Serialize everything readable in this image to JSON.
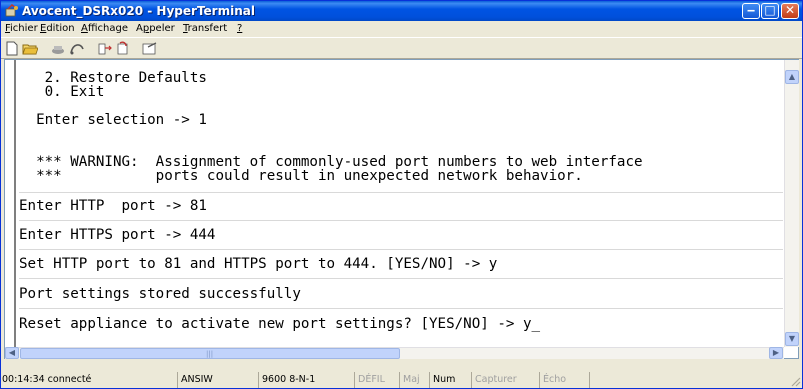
{
  "window": {
    "title": "Avocent_DSRx020 - HyperTerminal",
    "minimize": "‒",
    "maximize": "□",
    "close": "✕"
  },
  "menu": {
    "items": [
      "Fichier",
      "Edition",
      "Affichage",
      "Appeler",
      "Transfert",
      "?"
    ]
  },
  "toolbar": {
    "icons": [
      "new-connection-icon",
      "open-icon",
      "dial-icon",
      "disconnect-icon",
      "send-icon",
      "receive-icon",
      "properties-icon"
    ]
  },
  "terminal": {
    "lines": [
      "   2. Restore Defaults",
      "   0. Exit",
      "",
      "  Enter selection -> 1",
      "",
      "",
      "  *** WARNING:  Assignment of commonly-used port numbers to web interface",
      "  ***           ports could result in unexpected network behavior.",
      "",
      "Enter HTTP  port -> 81",
      "",
      "Enter HTTPS port -> 444",
      "",
      "Set HTTP port to 81 and HTTPS port to 444. [YES/NO] -> y",
      "",
      "Port settings stored successfully",
      "",
      "Reset appliance to activate new port settings? [YES/NO] -> y_"
    ]
  },
  "status": {
    "connected": "00:14:34 connecté",
    "emulation": "ANSIW",
    "settings": "9600 8-N-1",
    "scroll": "DÉFIL",
    "caps": "Maj",
    "num": "Num",
    "capture": "Capturer",
    "echo": "Écho"
  }
}
